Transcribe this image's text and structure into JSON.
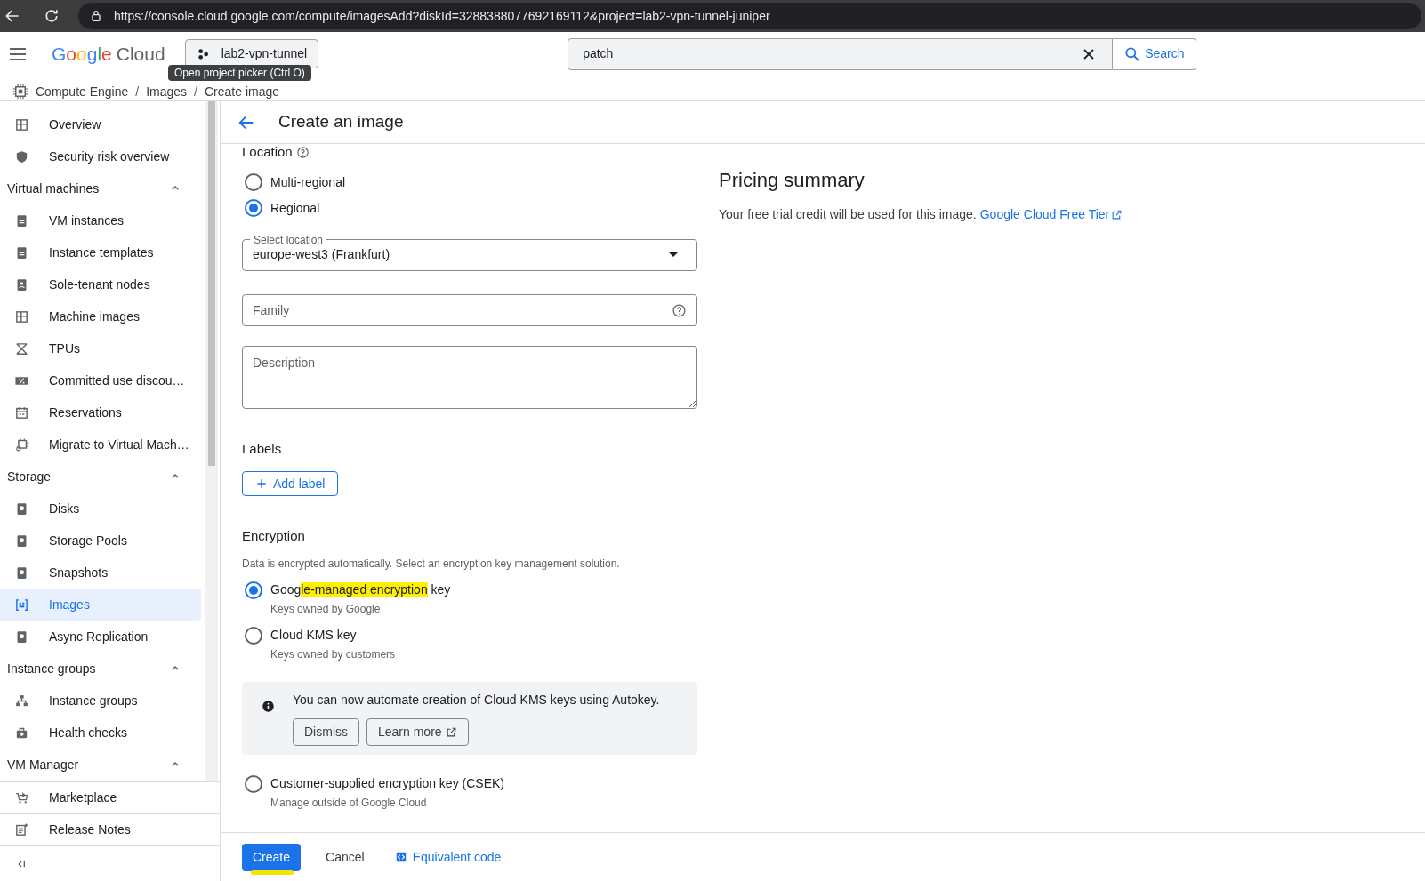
{
  "browser": {
    "url": "https://console.cloud.google.com/compute/imagesAdd?diskId=3288388077692169112&project=lab2-vpn-tunnel-juniper"
  },
  "header": {
    "logo_google": "Google",
    "logo_cloud": "Cloud",
    "project": "lab2-vpn-tunnel",
    "tooltip": "Open project picker (Ctrl O)",
    "search_value": "patch",
    "search_button": "Search"
  },
  "breadcrumb": {
    "separator": "/",
    "items": [
      "Compute Engine",
      "Images",
      "Create image"
    ]
  },
  "sidebar": {
    "items": [
      {
        "kind": "item",
        "label": "Overview",
        "selected": false
      },
      {
        "kind": "item",
        "label": "Security risk overview",
        "selected": false
      },
      {
        "kind": "section",
        "label": "Virtual machines",
        "expanded": true
      },
      {
        "kind": "item",
        "label": "VM instances",
        "selected": false
      },
      {
        "kind": "item",
        "label": "Instance templates",
        "selected": false
      },
      {
        "kind": "item",
        "label": "Sole-tenant nodes",
        "selected": false
      },
      {
        "kind": "item",
        "label": "Machine images",
        "selected": false
      },
      {
        "kind": "item",
        "label": "TPUs",
        "selected": false
      },
      {
        "kind": "item",
        "label": "Committed use discou…",
        "selected": false
      },
      {
        "kind": "item",
        "label": "Reservations",
        "selected": false
      },
      {
        "kind": "item",
        "label": "Migrate to Virtual Mach…",
        "selected": false
      },
      {
        "kind": "section",
        "label": "Storage",
        "expanded": true
      },
      {
        "kind": "item",
        "label": "Disks",
        "selected": false
      },
      {
        "kind": "item",
        "label": "Storage Pools",
        "selected": false
      },
      {
        "kind": "item",
        "label": "Snapshots",
        "selected": false
      },
      {
        "kind": "item",
        "label": "Images",
        "selected": true
      },
      {
        "kind": "item",
        "label": "Async Replication",
        "selected": false
      },
      {
        "kind": "section",
        "label": "Instance groups",
        "expanded": true
      },
      {
        "kind": "item",
        "label": "Instance groups",
        "selected": false
      },
      {
        "kind": "item",
        "label": "Health checks",
        "selected": false
      },
      {
        "kind": "section",
        "label": "VM Manager",
        "expanded": true
      }
    ],
    "footer_items": [
      "Marketplace",
      "Release Notes"
    ]
  },
  "page": {
    "title": "Create an image",
    "location": {
      "heading": "Location",
      "options": [
        {
          "label": "Multi-regional",
          "selected": false
        },
        {
          "label": "Regional",
          "selected": true
        }
      ],
      "select_label": "Select location",
      "select_value": "europe-west3 (Frankfurt)"
    },
    "family": {
      "placeholder": "Family"
    },
    "description": {
      "placeholder": "Description"
    },
    "labels": {
      "heading": "Labels",
      "button": "Add label"
    },
    "encryption": {
      "heading": "Encryption",
      "note": "Data is encrypted automatically. Select an encryption key management solution.",
      "options": [
        {
          "label_parts": [
            {
              "text": "Goog",
              "highlighted": false
            },
            {
              "text": "le-managed encryption",
              "highlighted": true
            },
            {
              "text": " key",
              "highlighted": false
            }
          ],
          "sub": "Keys owned by Google",
          "selected": true
        },
        {
          "label_parts": [
            {
              "text": "Cloud KMS key",
              "highlighted": false
            }
          ],
          "sub": "Keys owned by customers",
          "selected": false
        },
        {
          "label_parts": [
            {
              "text": "Customer-supplied encryption key (CSEK)",
              "highlighted": false
            }
          ],
          "sub": "Manage outside of Google Cloud",
          "selected": false
        }
      ],
      "banner": {
        "text": "You can now automate creation of Cloud KMS keys using Autokey.",
        "buttons": [
          "Dismiss",
          "Learn more"
        ]
      }
    },
    "pricing": {
      "heading": "Pricing summary",
      "text": "Your free trial credit will be used for this image.",
      "link": "Google Cloud Free Tier"
    },
    "actions": {
      "create": "Create",
      "create_marked": true,
      "cancel": "Cancel",
      "code": "Equivalent code"
    }
  }
}
